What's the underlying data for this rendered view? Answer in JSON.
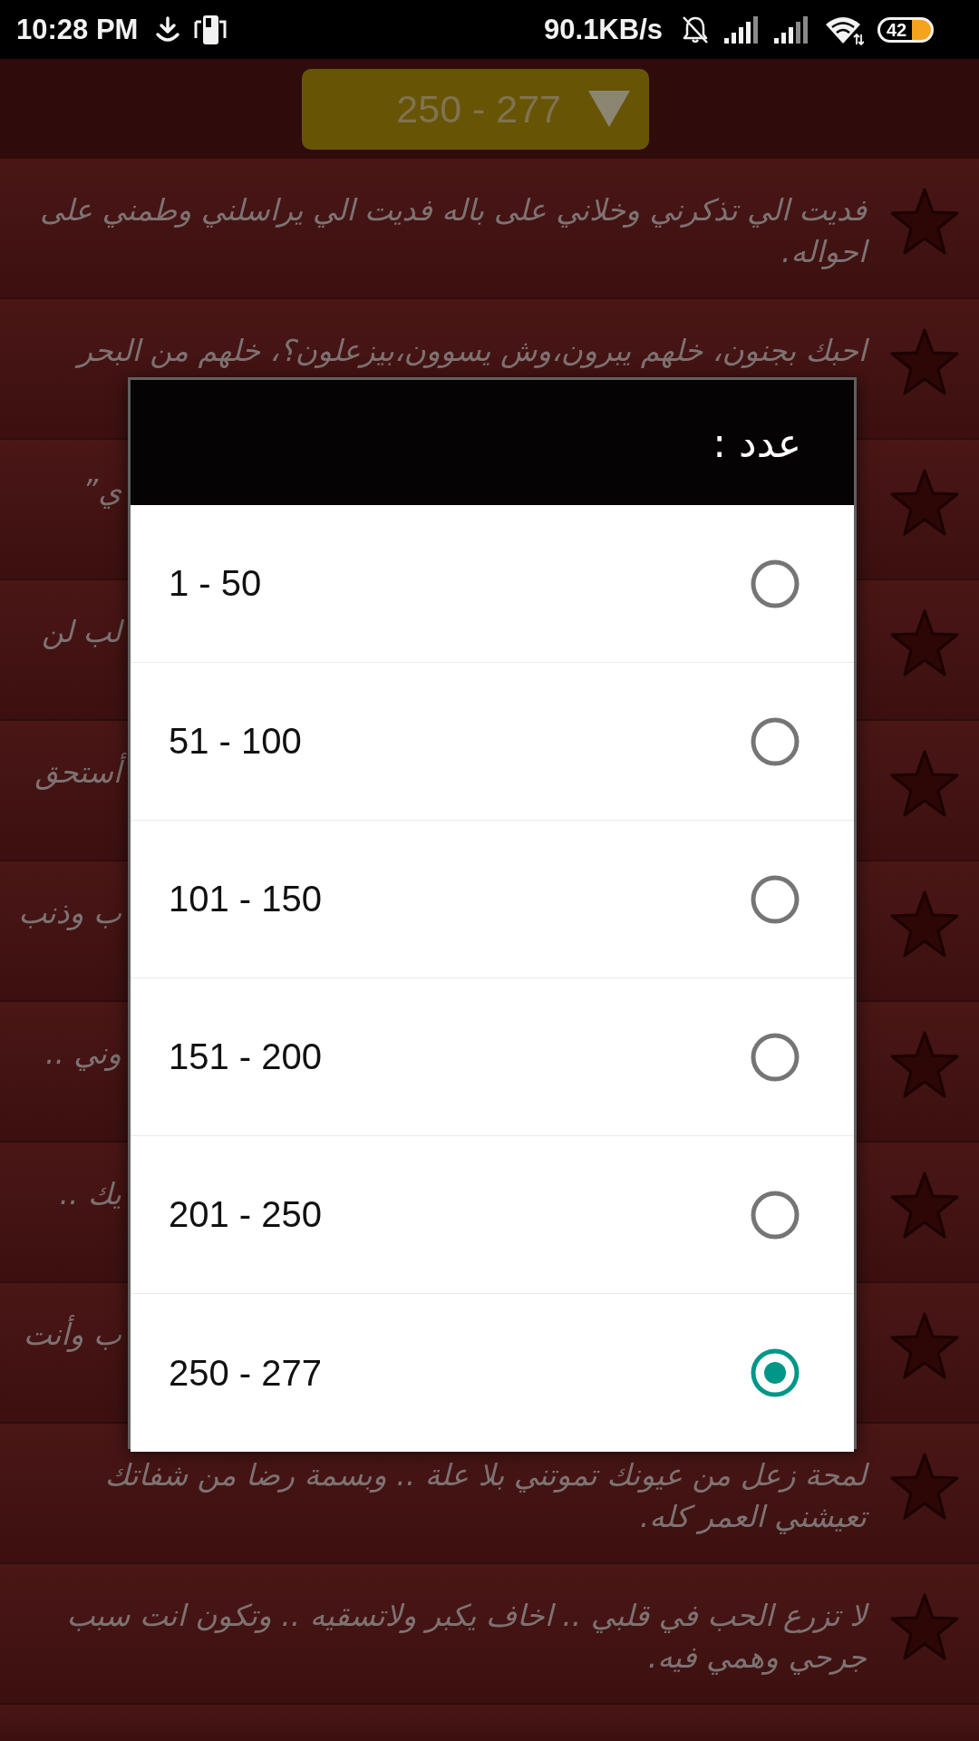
{
  "status_bar": {
    "time": "10:28 PM",
    "speed": "90.1KB/s",
    "battery": "42"
  },
  "range_dropdown": {
    "value": "250 - 277"
  },
  "messages": [
    {
      "kind": "full",
      "lines": [
        "فديت الي تذكرني وخلاني على باله فديت الي يراسلني وطمني على",
        "احواله."
      ]
    },
    {
      "kind": "full",
      "lines": [
        "احبك بجنون، خلهم يبرون،وش يسوون،بيزعلون؟، خلهم من البحر"
      ]
    },
    {
      "kind": "partial",
      "fragment": "ي”"
    },
    {
      "kind": "partial",
      "fragment": "لب لن"
    },
    {
      "kind": "partial",
      "fragment": "أستحق"
    },
    {
      "kind": "partial",
      "fragment": "ب وذنب"
    },
    {
      "kind": "partial",
      "fragment": "وني .."
    },
    {
      "kind": "partial",
      "fragment": "يك .."
    },
    {
      "kind": "partial",
      "fragment": "ب وأنت"
    },
    {
      "kind": "full",
      "lines": [
        "لمحة زعل من عيونك تموتني بلا علة .. وبسمة رضا من شفاتك",
        "تعيشني العمر كله."
      ]
    },
    {
      "kind": "full",
      "lines": [
        "لا تزرع الحب في قلبي .. اخاف يكبر ولاتسقيه .. وتكون انت سبب",
        "جرحي وهمي فيه."
      ]
    }
  ],
  "dialog": {
    "title": "عدد :",
    "options": [
      {
        "label": "1 - 50",
        "selected": false
      },
      {
        "label": "51 - 100",
        "selected": false
      },
      {
        "label": "101 - 150",
        "selected": false
      },
      {
        "label": "151 - 200",
        "selected": false
      },
      {
        "label": "201 - 250",
        "selected": false
      },
      {
        "label": "250 - 277",
        "selected": true
      }
    ]
  }
}
